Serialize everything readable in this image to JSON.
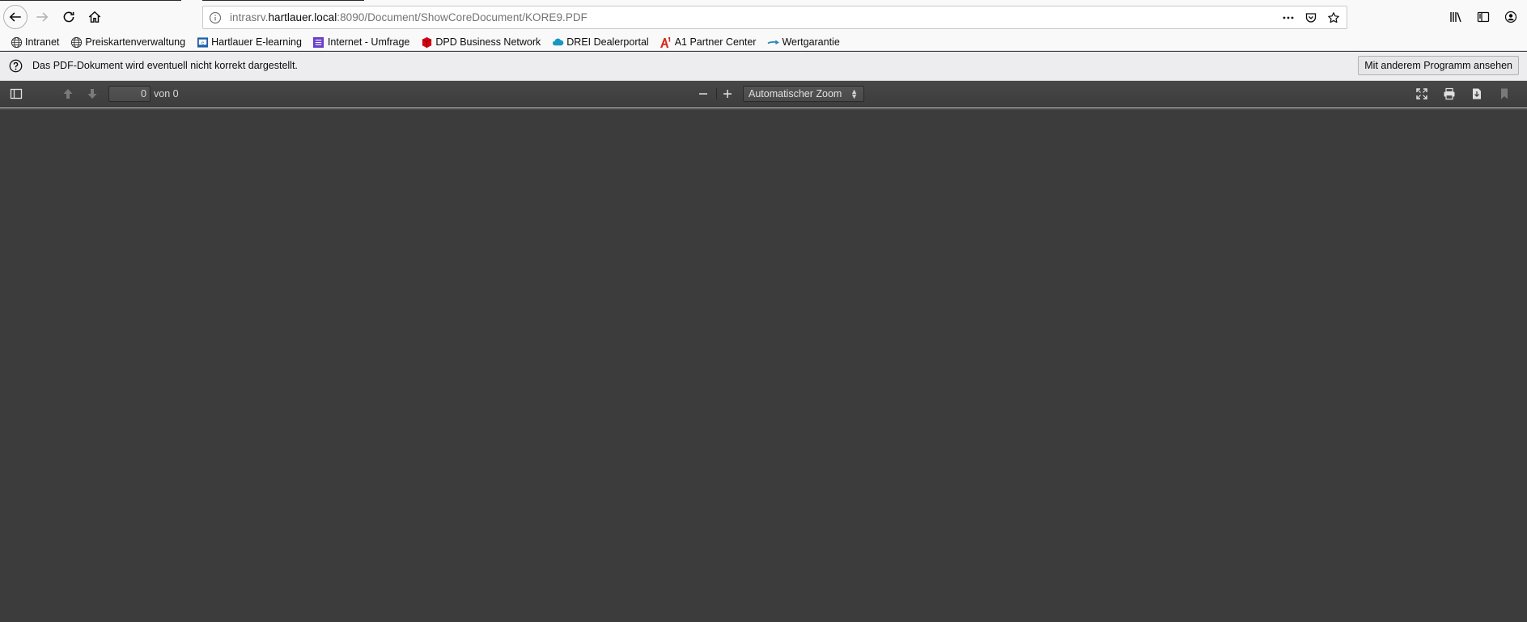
{
  "browser": {
    "url": {
      "prefix": "intrasrv.",
      "host": "hartlauer.local",
      "suffix": ":8090/Document/ShowCoreDocument/KORE9.PDF"
    },
    "icons": {
      "back": "arrow-left-icon",
      "forward": "arrow-right-icon",
      "reload": "reload-icon",
      "home": "home-icon",
      "site_info": "info-icon",
      "page_actions": "more-dots-icon",
      "pocket": "pocket-icon",
      "star": "star-icon",
      "library": "library-icon",
      "sidebar": "sidebar-icon",
      "account": "account-icon"
    }
  },
  "bookmarks": [
    {
      "label": "Intranet",
      "icon": "globe-icon"
    },
    {
      "label": "Preiskartenverwaltung",
      "icon": "globe-icon"
    },
    {
      "label": "Hartlauer E-learning",
      "icon": "elearning-icon"
    },
    {
      "label": "Internet - Umfrage",
      "icon": "survey-icon"
    },
    {
      "label": "DPD Business Network",
      "icon": "dpd-icon"
    },
    {
      "label": "DREI Dealerportal",
      "icon": "cloud-icon"
    },
    {
      "label": "A1 Partner Center",
      "icon": "a1-icon"
    },
    {
      "label": "Wertgarantie",
      "icon": "arrow-icon"
    }
  ],
  "notification": {
    "message": "Das PDF-Dokument wird eventuell nicht korrekt dargestellt.",
    "button_label": "Mit anderem Programm ansehen",
    "icon": "question-icon"
  },
  "pdf_toolbar": {
    "page_number": "0",
    "page_total": "von 0",
    "zoom_label": "Automatischer Zoom",
    "icons": {
      "sidebar_toggle": "sidebar-toggle-icon",
      "previous": "arrow-up-icon",
      "next": "arrow-down-icon",
      "zoom_out": "minus-icon",
      "zoom_in": "plus-icon",
      "presentation": "fullscreen-icon",
      "print": "print-icon",
      "download": "download-icon",
      "bookmark": "bookmark-icon"
    }
  },
  "colors": {
    "toolbar_bg": "#474747",
    "viewer_bg": "#3c3c3c",
    "nav_bg": "#f9f9fa"
  }
}
